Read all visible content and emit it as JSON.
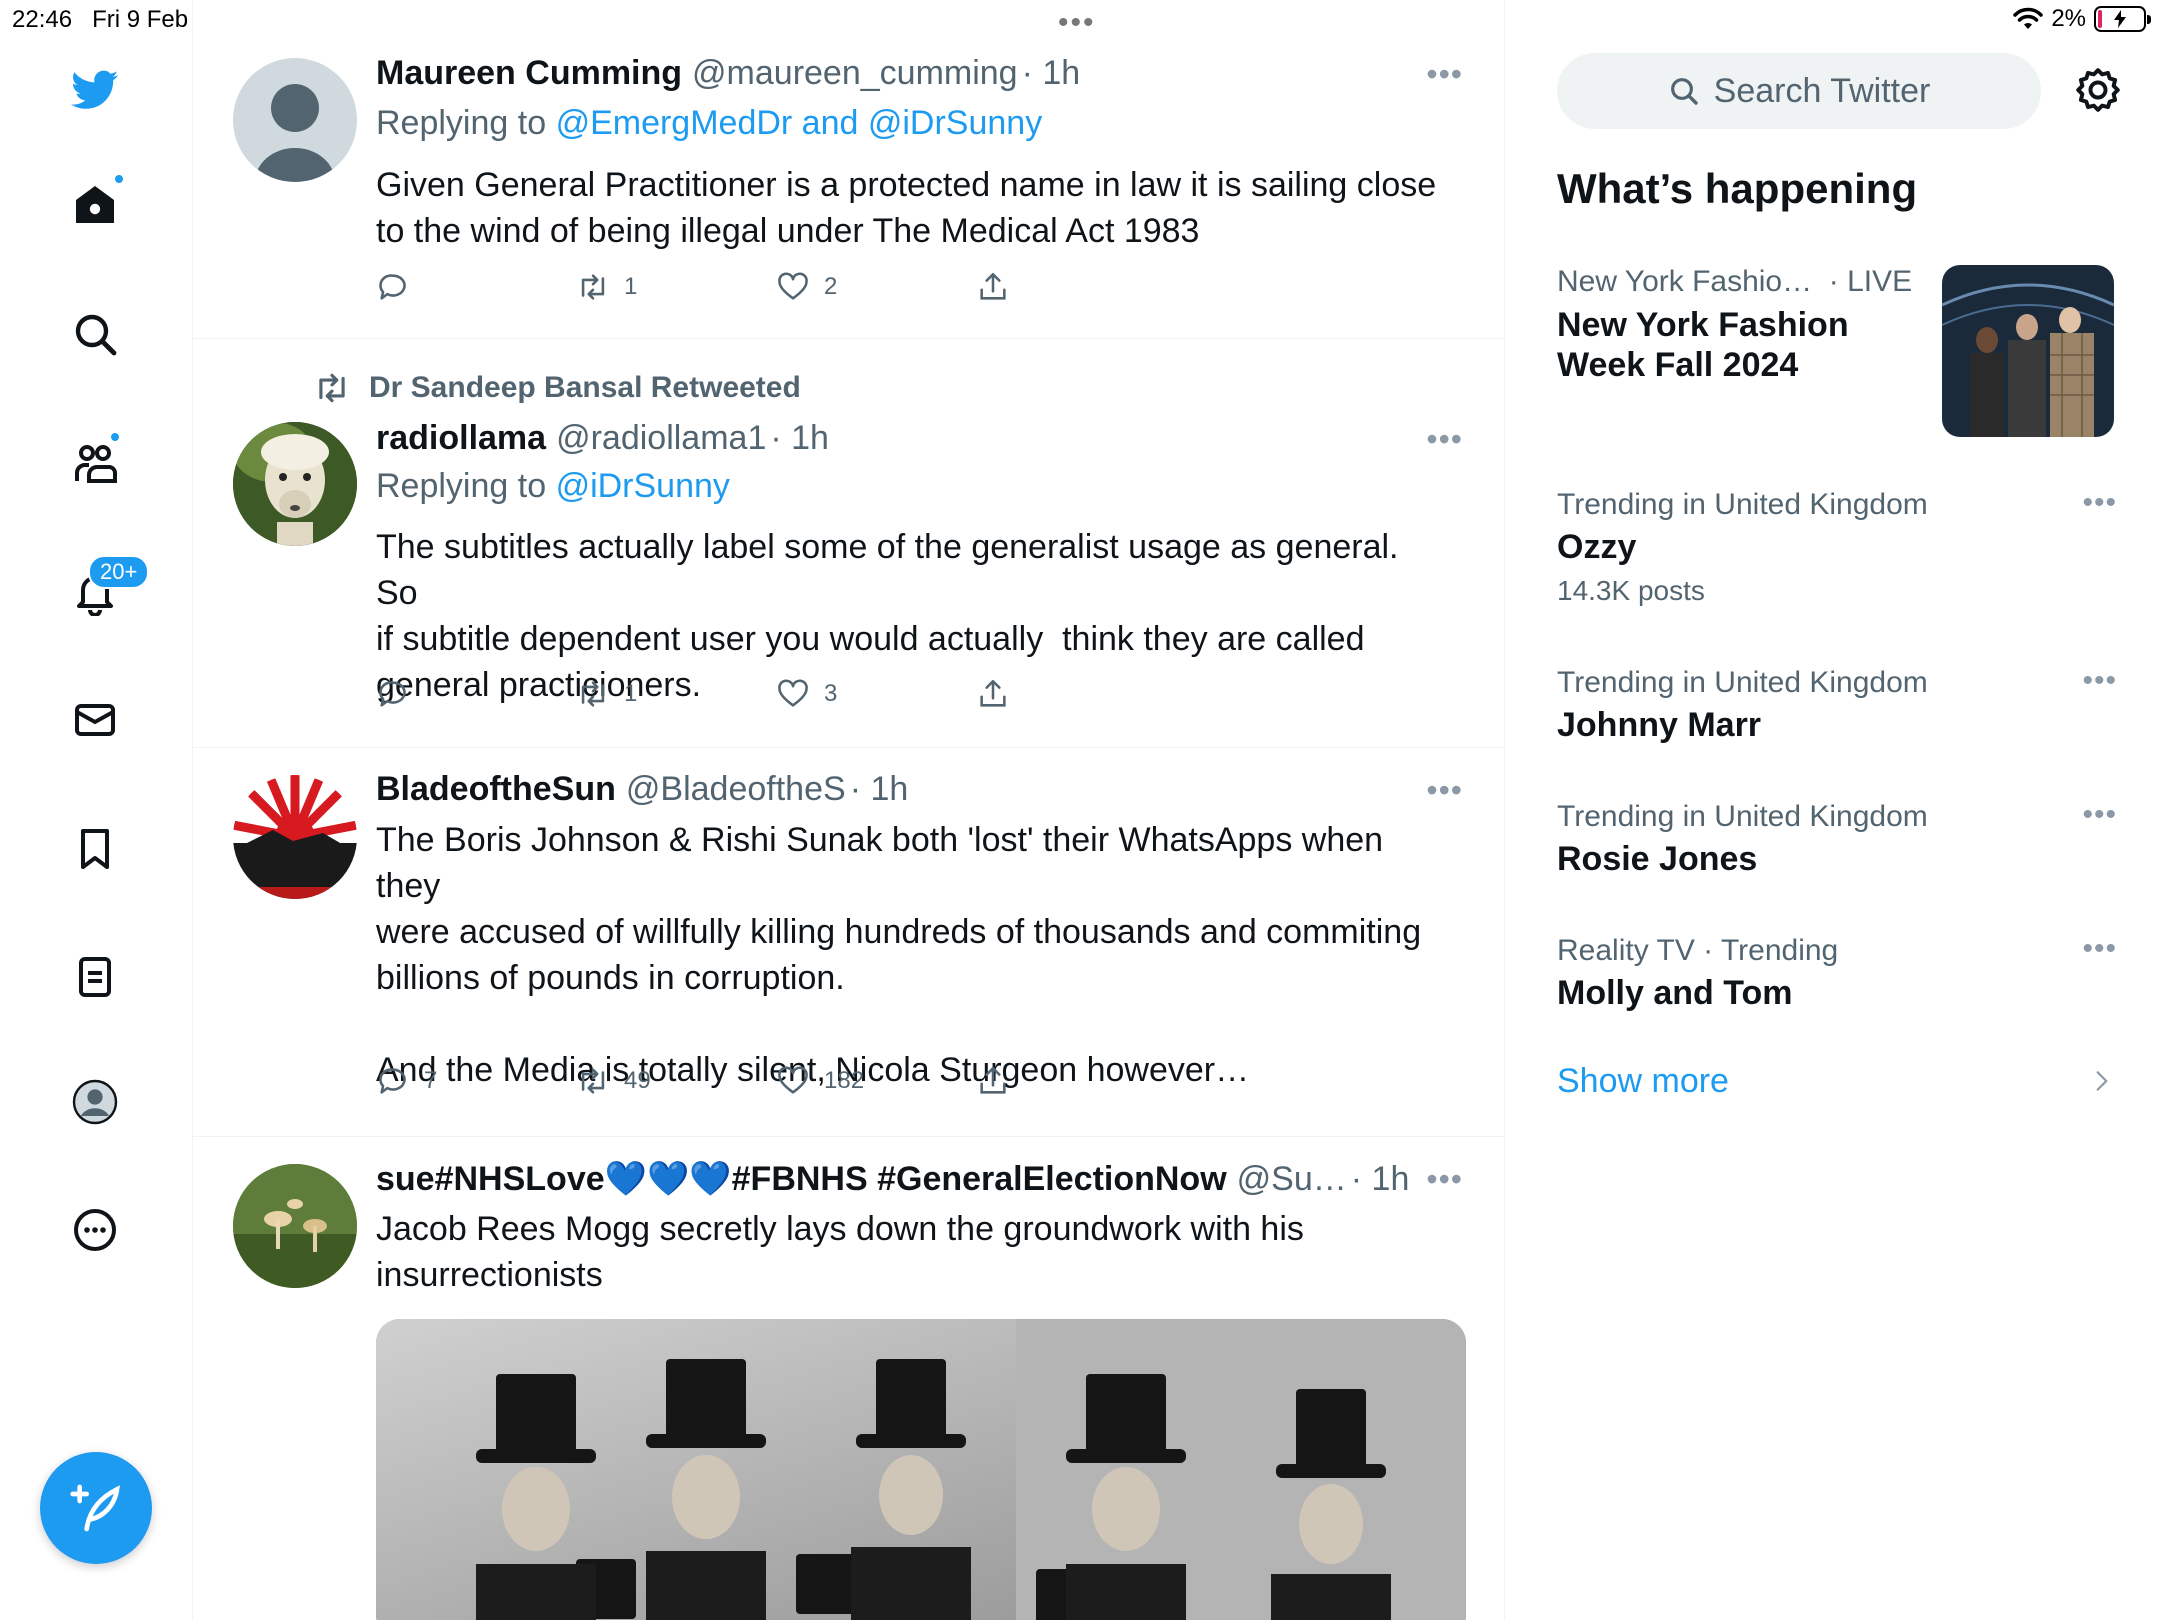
{
  "status_bar": {
    "time": "22:46",
    "date": "Fri 9 Feb",
    "battery": "2%"
  },
  "sidebar": {
    "items": [
      "twitter-logo",
      "home",
      "explore",
      "communities",
      "notifications",
      "messages",
      "bookmarks",
      "lists",
      "profile",
      "more"
    ],
    "notifications_badge": "20+"
  },
  "tweets": [
    {
      "name": "Maureen Cumming",
      "handle": "@maureen_cumming",
      "time": "· 1h",
      "reply_prefix": "Replying to",
      "reply_to": "@EmergMedDr and @iDrSunny",
      "text": "Given General Practitioner is a protected name in law it is sailing close\nto the wind of being illegal under The Medical Act 1983",
      "replies": "",
      "retweets": "1",
      "likes": "2"
    },
    {
      "retweeted_by": "Dr Sandeep Bansal Retweeted",
      "name": "radiollama",
      "handle": "@radiollama1",
      "time": "· 1h",
      "reply_prefix": "Replying to",
      "reply_to": "@iDrSunny",
      "text": "The subtitles actually label some of the generalist usage as general. So\nif subtitle dependent user you would actually  think they are called\ngeneral practicioners.",
      "replies": "",
      "retweets": "1",
      "likes": "3"
    },
    {
      "name": "BladeoftheSun",
      "handle": "@BladeoftheS",
      "time": "· 1h",
      "text": "The Boris Johnson & Rishi Sunak both 'lost' their WhatsApps when they\nwere accused of willfully killing hundreds of thousands and commiting\nbillions of pounds in corruption.\n\nAnd the Media is totally silent, Nicola Sturgeon however…",
      "replies": "7",
      "retweets": "49",
      "likes": "182"
    },
    {
      "name": "sue#NHSLove💙💙💙#FBNHS #GeneralElectionNow",
      "handle": "@Su…",
      "time": "· 1h",
      "text": "Jacob Rees Mogg secretly lays down the groundwork with his\ninsurrectionists"
    }
  ],
  "right": {
    "search_placeholder": "Search Twitter",
    "whats_happening": "What’s happening",
    "trends": [
      {
        "meta": "New York Fashio…",
        "live": "· LIVE",
        "name": "New York Fashion Week Fall 2024"
      },
      {
        "meta": "Trending in United Kingdom",
        "name": "Ozzy",
        "count": "14.3K posts"
      },
      {
        "meta": "Trending in United Kingdom",
        "name": "Johnny Marr"
      },
      {
        "meta": "Trending in United Kingdom",
        "name": "Rosie Jones"
      },
      {
        "meta": "Reality TV · Trending",
        "name": "Molly and Tom"
      }
    ],
    "show_more": "Show more"
  },
  "colors": {
    "accent": "#1d9bf0",
    "text": "#0f1419",
    "secondary": "#536471",
    "border": "#eff3f4"
  }
}
